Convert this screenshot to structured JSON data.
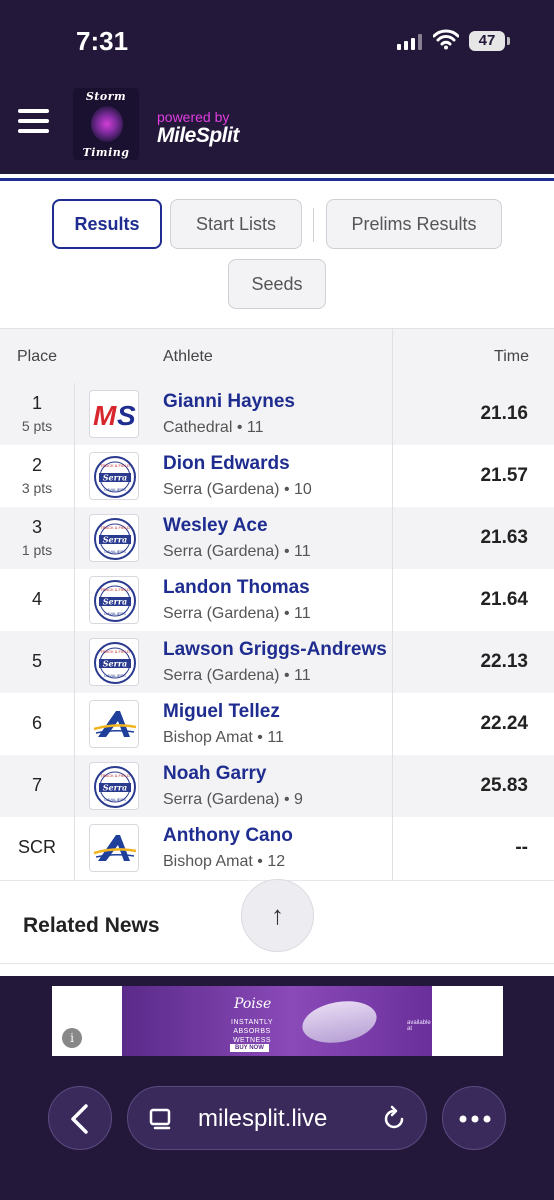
{
  "status_bar": {
    "time": "7:31",
    "battery": "47"
  },
  "header": {
    "logo_top": "Storm",
    "logo_bottom": "Timing",
    "powered_by": "powered by",
    "brand": "MileSplit"
  },
  "tabs": [
    {
      "label": "Results",
      "active": true
    },
    {
      "label": "Start Lists",
      "active": false
    },
    {
      "label": "Prelims Results",
      "active": false
    },
    {
      "label": "Seeds",
      "active": false
    }
  ],
  "table": {
    "headers": {
      "place": "Place",
      "athlete": "Athlete",
      "time": "Time"
    },
    "rows": [
      {
        "place": "1",
        "pts": "5 pts",
        "name": "Gianni Haynes",
        "team": "Cathedral • 11",
        "time": "21.16",
        "logo": "milesplit-logo"
      },
      {
        "place": "2",
        "pts": "3 pts",
        "name": "Dion Edwards",
        "team": "Serra (Gardena) • 10",
        "time": "21.57",
        "logo": "serra-logo"
      },
      {
        "place": "3",
        "pts": "1 pts",
        "name": "Wesley Ace",
        "team": "Serra (Gardena) • 11",
        "time": "21.63",
        "logo": "serra-logo"
      },
      {
        "place": "4",
        "pts": "",
        "name": "Landon Thomas",
        "team": "Serra (Gardena) • 11",
        "time": "21.64",
        "logo": "serra-logo"
      },
      {
        "place": "5",
        "pts": "",
        "name": "Lawson Griggs-Andrews",
        "team": "Serra (Gardena) • 11",
        "time": "22.13",
        "logo": "serra-logo"
      },
      {
        "place": "6",
        "pts": "",
        "name": "Miguel Tellez",
        "team": "Bishop Amat • 11",
        "time": "22.24",
        "logo": "bishop-amat-logo"
      },
      {
        "place": "7",
        "pts": "",
        "name": "Noah Garry",
        "team": "Serra (Gardena) • 9",
        "time": "25.83",
        "logo": "serra-logo"
      },
      {
        "place": "SCR",
        "pts": "",
        "name": "Anthony Cano",
        "team": "Bishop Amat • 12",
        "time": "--",
        "logo": "bishop-amat-logo"
      }
    ]
  },
  "related_news": {
    "title": "Related News"
  },
  "scroll_top": {
    "icon": "↑"
  },
  "ad": {
    "brand": "Poise",
    "text": "INSTANTLY ABSORBS WETNESS",
    "button": "BUY NOW",
    "available": "available at",
    "info_icon": "i"
  },
  "browser": {
    "url": "milesplit.live"
  },
  "colors": {
    "header_bg": "#231839",
    "accent": "#1e2d8f",
    "brand_pink": "#e03ee0"
  },
  "serra_logo_text": {
    "top": "TRACK & FIELD",
    "mid": "Serra",
    "bottom": "CAVALIERS"
  }
}
